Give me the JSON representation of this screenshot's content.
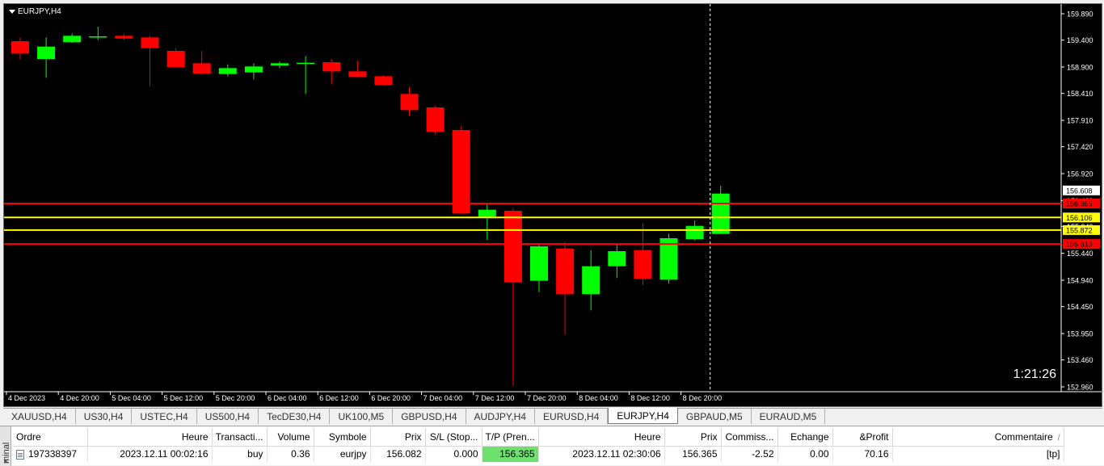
{
  "chart": {
    "symbol_title": "EURJPY,H4",
    "timer": "1:21:26",
    "colors": {
      "bull": "#00ff00",
      "bear": "#ff0000",
      "background": "#000000",
      "grid": "#ffffff",
      "level_red": "#ff0000",
      "level_yellow": "#ffff00"
    },
    "price_axis": [
      "159.890",
      "159.400",
      "158.900",
      "158.410",
      "157.910",
      "157.420",
      "156.920",
      "156.420",
      "155.940",
      "155.440",
      "154.940",
      "154.450",
      "153.950",
      "153.460",
      "152.960"
    ],
    "time_axis": [
      "4 Dec 2023",
      "4 Dec 20:00",
      "5 Dec 04:00",
      "5 Dec 12:00",
      "5 Dec 20:00",
      "6 Dec 04:00",
      "6 Dec 12:00",
      "6 Dec 20:00",
      "7 Dec 04:00",
      "7 Dec 12:00",
      "7 Dec 20:00",
      "8 Dec 04:00",
      "8 Dec 12:00",
      "8 Dec 20:00"
    ],
    "ohlc": [
      {
        "o": 159.38,
        "h": 159.45,
        "l": 159.05,
        "c": 159.15
      },
      {
        "o": 159.05,
        "h": 159.45,
        "l": 158.7,
        "c": 159.28
      },
      {
        "o": 159.36,
        "h": 159.52,
        "l": 159.35,
        "c": 159.48
      },
      {
        "o": 159.45,
        "h": 159.65,
        "l": 159.4,
        "c": 159.47
      },
      {
        "o": 159.48,
        "h": 159.52,
        "l": 159.4,
        "c": 159.43
      },
      {
        "o": 159.45,
        "h": 159.48,
        "l": 158.55,
        "c": 159.25
      },
      {
        "o": 159.2,
        "h": 159.25,
        "l": 158.89,
        "c": 158.9
      },
      {
        "o": 158.97,
        "h": 159.2,
        "l": 158.76,
        "c": 158.78
      },
      {
        "o": 158.77,
        "h": 158.95,
        "l": 158.73,
        "c": 158.88
      },
      {
        "o": 158.8,
        "h": 158.97,
        "l": 158.67,
        "c": 158.91
      },
      {
        "o": 158.93,
        "h": 159.0,
        "l": 158.88,
        "c": 158.97
      },
      {
        "o": 158.96,
        "h": 159.1,
        "l": 158.4,
        "c": 158.98
      },
      {
        "o": 158.99,
        "h": 159.05,
        "l": 158.58,
        "c": 158.82
      },
      {
        "o": 158.82,
        "h": 159.02,
        "l": 158.7,
        "c": 158.72
      },
      {
        "o": 158.73,
        "h": 158.75,
        "l": 158.55,
        "c": 158.57
      },
      {
        "o": 158.4,
        "h": 158.53,
        "l": 158.0,
        "c": 158.1
      },
      {
        "o": 158.15,
        "h": 158.18,
        "l": 157.65,
        "c": 157.7
      },
      {
        "o": 157.73,
        "h": 157.8,
        "l": 156.17,
        "c": 156.18
      },
      {
        "o": 156.12,
        "h": 156.35,
        "l": 155.69,
        "c": 156.25
      },
      {
        "o": 156.23,
        "h": 156.27,
        "l": 152.98,
        "c": 154.9
      },
      {
        "o": 154.93,
        "h": 155.6,
        "l": 154.72,
        "c": 155.57
      },
      {
        "o": 155.53,
        "h": 155.65,
        "l": 153.93,
        "c": 154.68
      },
      {
        "o": 154.68,
        "h": 155.5,
        "l": 154.38,
        "c": 155.2
      },
      {
        "o": 155.2,
        "h": 155.62,
        "l": 154.98,
        "c": 155.48
      },
      {
        "o": 155.5,
        "h": 156.0,
        "l": 154.85,
        "c": 154.97
      },
      {
        "o": 154.95,
        "h": 155.8,
        "l": 154.88,
        "c": 155.72
      },
      {
        "o": 155.7,
        "h": 156.05,
        "l": 155.68,
        "c": 155.95
      },
      {
        "o": 155.8,
        "h": 156.7,
        "l": 155.8,
        "c": 156.55
      }
    ],
    "levels": [
      {
        "price": 156.365,
        "label": "156.365",
        "color": "#ff0000",
        "label_bg": "#ff0000",
        "label_fg": "#000000"
      },
      {
        "price": 156.106,
        "label": "156.106",
        "color": "#ffff00",
        "label_bg": "#ffff00",
        "label_fg": "#000000"
      },
      {
        "price": 155.872,
        "label": "155.872",
        "color": "#ffff00",
        "label_bg": "#ffff00",
        "label_fg": "#000000"
      },
      {
        "price": 155.613,
        "label": "155.613",
        "color": "#ff0000",
        "label_bg": "#ff0000",
        "label_fg": "#000000"
      }
    ],
    "current_price": {
      "price": 156.608,
      "label": "156.608"
    }
  },
  "tabs": [
    "XAUUSD,H4",
    "US30,H4",
    "USTEC,H4",
    "US500,H4",
    "TecDE30,H4",
    "UK100,M5",
    "GBPUSD,H4",
    "AUDJPY,H4",
    "EURUSD,H4",
    "EURJPY,H4",
    "GBPAUD,M5",
    "EURAUD,M5"
  ],
  "active_tab": "EURJPY,H4",
  "terminal": {
    "side_label": "minal",
    "close_glyph": "×",
    "columns": [
      "Ordre",
      "Heure",
      "Transacti...",
      "Volume",
      "Symbole",
      "Prix",
      "S/L (Stop...",
      "T/P (Pren...",
      "Heure",
      "Prix",
      "Commiss...",
      "Echange",
      "&Profit",
      "Commentaire"
    ],
    "rows": [
      [
        "197338397",
        "2023.12.11 00:02:16",
        "buy",
        "0.36",
        "eurjpy",
        "156.082",
        "0.000",
        "156.365",
        "2023.12.11 02:30:06",
        "156.365",
        "-2.52",
        "0.00",
        "70.16",
        "[tp]"
      ]
    ]
  }
}
